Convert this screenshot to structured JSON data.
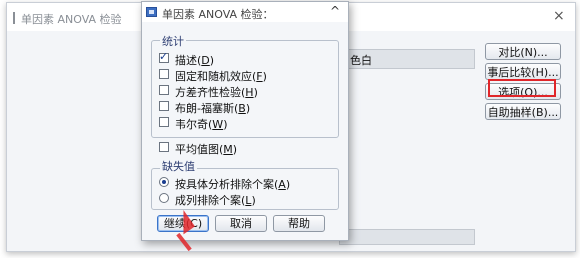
{
  "main_window": {
    "title": "单因素 ANOVA 检验",
    "close_glyph": "×",
    "dependent_list_text": "色白",
    "buttons": {
      "contrast": "对比(N)...",
      "post_hoc": "事后比较(H)...",
      "options": "选项(O)...",
      "bootstrap": "自助抽样(B)..."
    }
  },
  "options_dialog": {
    "title": "单因素 ANOVA 检验：",
    "close_glyph": "^",
    "statistics_group": {
      "label": "统计",
      "items": [
        {
          "label": "描述(",
          "key": "D",
          "suffix": ")",
          "checked": true
        },
        {
          "label": "固定和随机效应(",
          "key": "F",
          "suffix": ")",
          "checked": false
        },
        {
          "label": "方差齐性检验(",
          "key": "H",
          "suffix": ")",
          "checked": false
        },
        {
          "label": "布朗-福塞斯(",
          "key": "B",
          "suffix": ")",
          "checked": false
        },
        {
          "label": "韦尔奇(",
          "key": "W",
          "suffix": ")",
          "checked": false
        }
      ]
    },
    "means_plot": {
      "label": "平均值图(",
      "key": "M",
      "suffix": ")",
      "checked": false
    },
    "missing_group": {
      "label": "缺失值",
      "items": [
        {
          "label": "按具体分析排除个案(",
          "key": "A",
          "suffix": ")",
          "selected": true
        },
        {
          "label": "成列排除个案(",
          "key": "L",
          "suffix": ")",
          "selected": false
        }
      ]
    },
    "buttons": {
      "continue": "继续(C)",
      "cancel": "取消",
      "help": "帮助"
    }
  },
  "colors": {
    "highlight": "#e0262a",
    "group_label": "#2f3f73",
    "check": "#1a3d8f"
  }
}
